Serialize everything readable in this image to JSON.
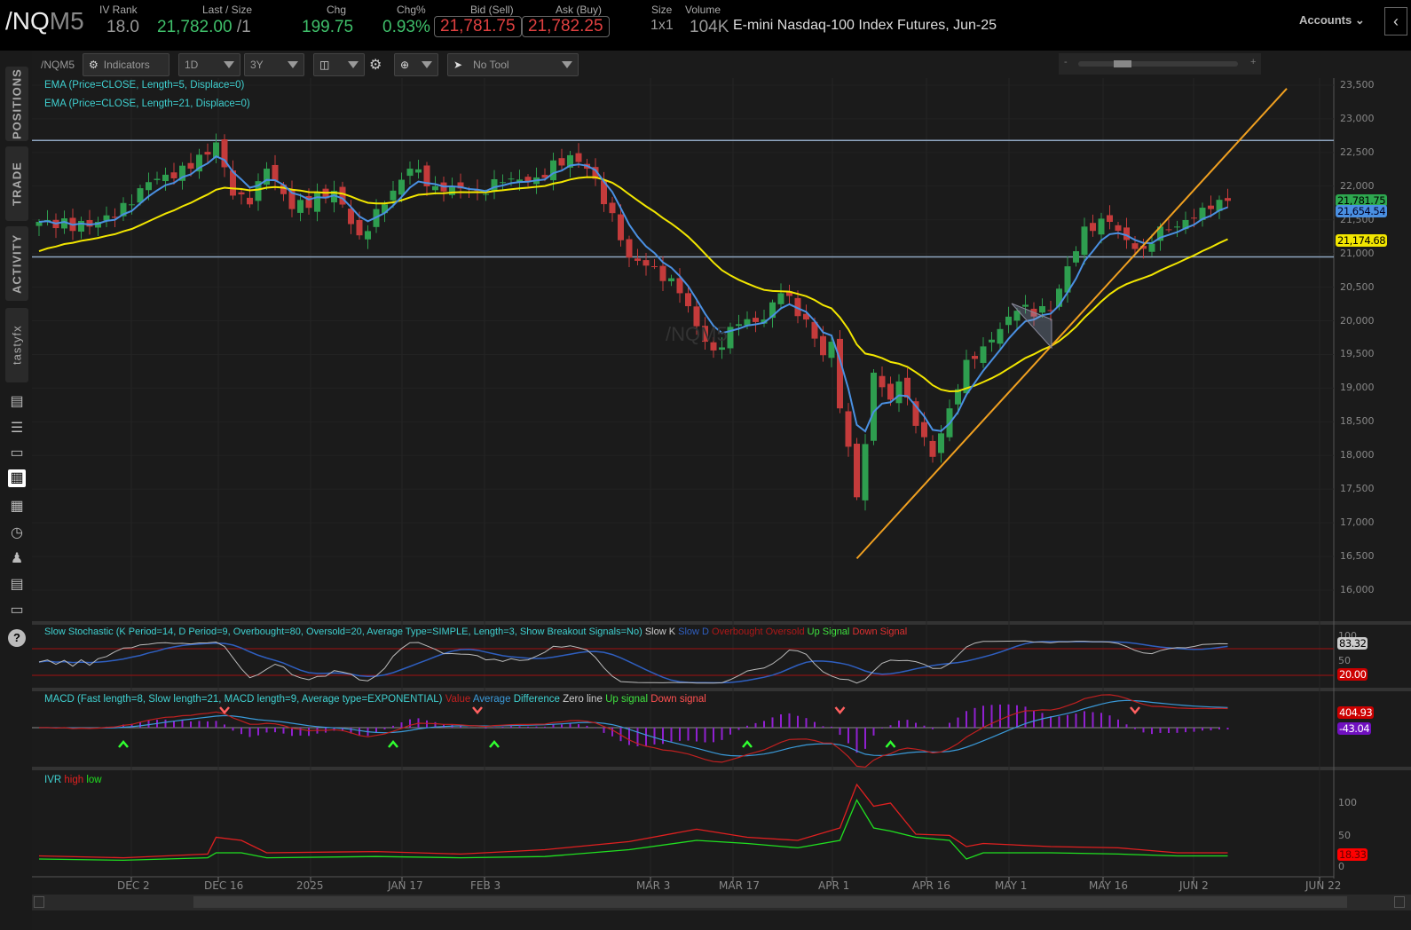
{
  "header": {
    "symbol_main": "/NQ",
    "symbol_suffix": "M5",
    "iv_rank_label": "IV Rank",
    "iv_rank": "18.0",
    "last_label": "Last / Size",
    "last": "21,782.00",
    "last_size": "/1",
    "chg_label": "Chg",
    "chg": "199.75",
    "chgpct_label": "Chg%",
    "chgpct": "0.93%",
    "bid_label": "Bid (Sell)",
    "bid": "21,781.75",
    "ask_label": "Ask (Buy)",
    "ask": "21,782.25",
    "size_label": "Size",
    "size": "1x1",
    "volume_label": "Volume",
    "volume": "104K",
    "description": "E-mini Nasdaq-100 Index Futures, Jun-25",
    "accounts": "Accounts"
  },
  "sidebar": {
    "tabs": [
      "POSITIONS",
      "TRADE",
      "ACTIVITY",
      "tastyfx"
    ]
  },
  "toolbar": {
    "symbol": "/NQM5",
    "indicators": "Indicators",
    "aggregation": "1D",
    "range": "3Y",
    "tool": "No Tool",
    "zoom_minus": "-",
    "zoom_plus": "+"
  },
  "studies": {
    "ema5": "EMA (Price=CLOSE, Length=5, Displace=0)",
    "ema21": "EMA (Price=CLOSE, Length=21, Displace=0)",
    "stoch": "Slow Stochastic (K Period=14, D Period=9, Overbought=80, Oversold=20, Average Type=SIMPLE, Length=3, Show Breakout Signals=No)",
    "stoch_legend": [
      "Slow K",
      "Slow D",
      "Overbought",
      "Oversold",
      "Up Signal",
      "Down Signal"
    ],
    "macd": "MACD (Fast length=8, Slow length=21, MACD length=9, Average type=EXPONENTIAL)",
    "macd_legend": [
      "Value",
      "Average",
      "Difference",
      "Zero line",
      "Up signal",
      "Down signal"
    ],
    "ivr": "IVR",
    "ivr_legend": [
      "high",
      "low"
    ]
  },
  "watermark": "/NQM5",
  "tags": {
    "last": "21,781.75",
    "ema5": "21,654.54",
    "ema21": "21,174.68",
    "stoch_k": "83.32",
    "stoch_os": "20.00",
    "macd_value": "404.93",
    "macd_diff": "-43.04",
    "ivr": "18.33"
  },
  "colors": {
    "up": "#2e9e4f",
    "down": "#c43b3b",
    "ema5": "#4a90e2",
    "ema21": "#f2e600",
    "trend": "#f0a020",
    "level": "#8fa6c0"
  },
  "chart_data": {
    "type": "candlestick",
    "price_axis": [
      "23,500",
      "23,000",
      "22,500",
      "22,000",
      "21,500",
      "21,000",
      "20,500",
      "20,000",
      "19,500",
      "19,000",
      "18,500",
      "18,000",
      "17,500",
      "17,000",
      "16,500",
      "16,000"
    ],
    "stoch_axis": [
      "100",
      "50"
    ],
    "ivr_axis": [
      "100",
      "50",
      "0"
    ],
    "date_labels": [
      "DEC 2",
      "DEC 16",
      "2025",
      "JAN 17",
      "FEB 3",
      "MAR 3",
      "MAR 17",
      "APR 1",
      "APR 16",
      "MAY 1",
      "MAY 16",
      "JUN 2",
      "JUN 22"
    ],
    "close_waypoints": [
      [
        0,
        21470
      ],
      [
        6,
        21400
      ],
      [
        11,
        21730
      ],
      [
        13,
        22060
      ],
      [
        18,
        22260
      ],
      [
        21,
        22650
      ],
      [
        23,
        21860
      ],
      [
        25,
        21730
      ],
      [
        27,
        22260
      ],
      [
        30,
        21660
      ],
      [
        35,
        21930
      ],
      [
        38,
        21270
      ],
      [
        41,
        21730
      ],
      [
        44,
        22260
      ],
      [
        47,
        22000
      ],
      [
        52,
        21930
      ],
      [
        55,
        22060
      ],
      [
        59,
        22130
      ],
      [
        63,
        22460
      ],
      [
        65,
        22260
      ],
      [
        68,
        21600
      ],
      [
        70,
        20940
      ],
      [
        73,
        20810
      ],
      [
        76,
        20410
      ],
      [
        79,
        19690
      ],
      [
        80,
        19560
      ],
      [
        83,
        19950
      ],
      [
        86,
        20020
      ],
      [
        88,
        20410
      ],
      [
        91,
        20020
      ],
      [
        93,
        19490
      ],
      [
        94,
        19690
      ],
      [
        95,
        18700
      ],
      [
        97,
        17380
      ],
      [
        98,
        18170
      ],
      [
        99,
        19230
      ],
      [
        101,
        18830
      ],
      [
        102,
        19100
      ],
      [
        104,
        18440
      ],
      [
        106,
        17980
      ],
      [
        108,
        18700
      ],
      [
        110,
        19420
      ],
      [
        112,
        19620
      ],
      [
        116,
        20150
      ],
      [
        120,
        20150
      ],
      [
        122,
        20810
      ],
      [
        124,
        21400
      ],
      [
        127,
        21470
      ],
      [
        129,
        21200
      ],
      [
        131,
        21070
      ],
      [
        133,
        21400
      ],
      [
        135,
        21400
      ],
      [
        137,
        21530
      ],
      [
        139,
        21660
      ],
      [
        141,
        21782
      ]
    ],
    "levels": [
      22680,
      20950
    ],
    "trendline": [
      [
        97,
        16470
      ],
      [
        148,
        23450
      ]
    ],
    "ivr_waypoints": [
      [
        0,
        15,
        10
      ],
      [
        10,
        12,
        8
      ],
      [
        20,
        18,
        12
      ],
      [
        21,
        45,
        20
      ],
      [
        24,
        40,
        20
      ],
      [
        27,
        20,
        12
      ],
      [
        40,
        22,
        14
      ],
      [
        50,
        18,
        12
      ],
      [
        60,
        25,
        14
      ],
      [
        70,
        38,
        25
      ],
      [
        78,
        58,
        40
      ],
      [
        84,
        45,
        35
      ],
      [
        90,
        40,
        28
      ],
      [
        95,
        60,
        40
      ],
      [
        97,
        130,
        105
      ],
      [
        99,
        95,
        60
      ],
      [
        101,
        100,
        55
      ],
      [
        104,
        50,
        45
      ],
      [
        108,
        48,
        40
      ],
      [
        110,
        30,
        10
      ],
      [
        112,
        35,
        20
      ],
      [
        120,
        30,
        20
      ],
      [
        128,
        28,
        18
      ],
      [
        135,
        20,
        15
      ],
      [
        141,
        20,
        15
      ]
    ],
    "macd_down_signals": [
      22,
      52,
      95,
      130
    ],
    "macd_up_signals": [
      10,
      42,
      54,
      84,
      101
    ]
  }
}
